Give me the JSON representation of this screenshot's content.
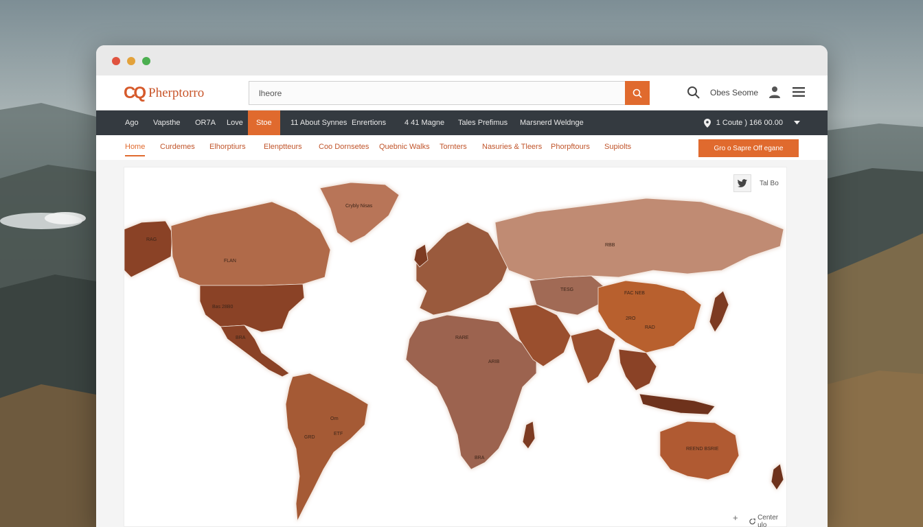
{
  "header": {
    "logo_mark": "CQ",
    "logo_text": "Pherptorro",
    "search_value": "lheore",
    "user_text": "Obes Seome"
  },
  "nav": {
    "items": [
      "Ago",
      "Vapsthe",
      "OR7A",
      "Love",
      "Stoe",
      "11 About Synnes",
      "Enrertions",
      "4 41 Magne",
      "Tales Prefimus",
      "Marsnerd Weldnge"
    ],
    "location_text": "1 Coute ) 166 00.00"
  },
  "subnav": {
    "items": [
      "Home",
      "Curdemes",
      "Elhorptiurs",
      "Elenptteurs",
      "Coo Dornsetes",
      "Quebnic Walks",
      "Tornters",
      "Nasuries & Tleers",
      "Phorpftours",
      "Supiolts"
    ],
    "cta_label": "Gro o Sapre Off egane"
  },
  "map": {
    "twitter_label": "Tal Bo",
    "zoom_in_label": "+",
    "center_label": "Center ulo",
    "labels": {
      "alaska": "RAG",
      "canada": "FLAN",
      "greenland": "Crybly Nisas",
      "usa": "Bas 28B0",
      "mexico": "BRA",
      "russia": "RBB",
      "kazakh": "TESG",
      "china_top": "FAC NEB",
      "china": "2RO",
      "china_right": "RAD",
      "brazil": "Orn",
      "brazil_b": "ETF",
      "peru": "GRD",
      "africa_n": "RARE",
      "africa_c": "ARIB",
      "south_africa": "BRA",
      "australia": "REEND BSRIE"
    }
  },
  "colors": {
    "accent": "#e06a2e",
    "nav_bg": "#343a40",
    "land_dark": "#8a4225",
    "land_mid": "#b06a48",
    "land_light": "#c8957c"
  },
  "icons": {
    "search": "search-icon",
    "user": "user-icon",
    "menu": "hamburger-menu-icon",
    "pin": "location-pin-icon",
    "chevron": "chevron-down-icon",
    "twitter": "twitter-icon",
    "center": "recenter-icon"
  }
}
